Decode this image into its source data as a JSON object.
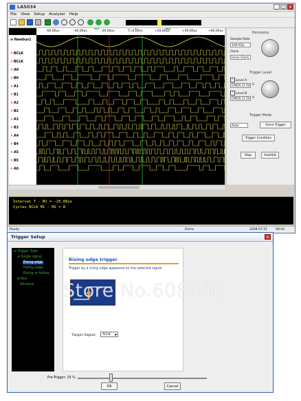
{
  "app": {
    "title": "LA5034",
    "menu": [
      "File",
      "View",
      "Setup",
      "Analyzer",
      "Help"
    ]
  },
  "toolbar": {
    "icons": [
      "new-icon",
      "open-icon",
      "save-icon",
      "print-icon",
      "run-icon",
      "capture-icon",
      "zoom-in-icon",
      "zoom-out-icon",
      "zoom-fit-icon",
      "nav-left-icon",
      "nav-right-icon",
      "nav-up-icon"
    ]
  },
  "scope": {
    "time_ticks": [
      "-60.00us",
      "-40.00us",
      "-20.00us",
      "T=0.00ns",
      "+20.00us",
      "+40.00us",
      "+60.00us"
    ],
    "markers": {
      "m1": "M1",
      "t": "T",
      "m2": "M2"
    },
    "bus_label": "Newbus1",
    "channels": [
      "BCLK",
      "BCLK",
      "A0",
      "B0",
      "A1",
      "B1",
      "A2",
      "B2",
      "A3",
      "B3",
      "A4",
      "B4",
      "A5",
      "B5",
      "A6"
    ]
  },
  "right_panel": {
    "horizontal_title": "Horizonta",
    "sample_rate_label": "Sample Rate",
    "sample_rate_value": "100 KSa",
    "clock_label": "Clock",
    "clock_value": "Inner Clock",
    "trigger_level_title": "Trigger Level",
    "level_a_label": "Level A",
    "level_a_value": "CMOS (2.5V",
    "level_b_label": "Level B",
    "level_b_value": "CMOS (2.5V",
    "volt_unit": "V",
    "trigger_mode_title": "Trigger Mode",
    "mode_value": "Auto",
    "force_trigger": "Force Trigger",
    "trigger_condition": "Trigger Condition",
    "stop": "Stop",
    "autoset": "AutoSet"
  },
  "info": {
    "line1": "Interval  T - M1 = -25.60us",
    "line2": "Cycles  BCLK  M1 - M2 = 8"
  },
  "status": {
    "left": "Ready",
    "middle": "Demo",
    "date": "2008-07-21",
    "time": "08:44"
  },
  "dialog": {
    "title": "Trigger Setup",
    "tree": {
      "root": "Trigger Type",
      "single": "Single signal",
      "rising": "Rising edge",
      "falling": "Falling edge",
      "rise_fall": "Rising or falling",
      "bus": "Bus",
      "advance": "Advance"
    },
    "panel_title": "Rising edge trigger",
    "description": "Trigger by a rising edge appeared on the selected signal",
    "target_signal_label": "Target Signal:",
    "target_signal_value": "ACLK",
    "pretrigger_label": "Pre-Trigger:  25 %",
    "ok": "OK",
    "cancel": "Cancel"
  },
  "watermark": "Store No.608446"
}
